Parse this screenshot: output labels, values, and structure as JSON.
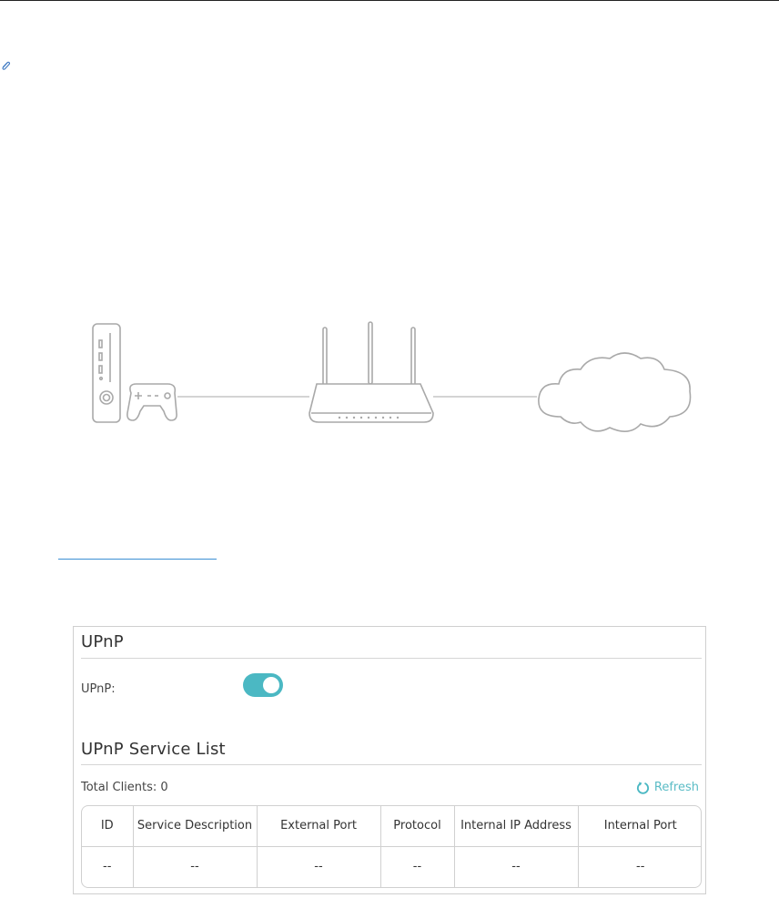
{
  "upnp_section": {
    "title": "UPnP",
    "toggle_label": "UPnP:",
    "toggle_state": "on"
  },
  "service_list": {
    "title": "UPnP Service List",
    "total_clients": "Total Clients: 0",
    "refresh_label": "Refresh",
    "columns": [
      "ID",
      "Service Description",
      "External Port",
      "Protocol",
      "Internal IP Address",
      "Internal Port"
    ],
    "rows": [
      [
        "--",
        "--",
        "--",
        "--",
        "--",
        "--"
      ]
    ]
  },
  "colors": {
    "accent": "#4bb8c3",
    "refresh": "#5bbcc6",
    "link": "#3c8fd4",
    "border": "#d0d0d0"
  },
  "icons": [
    "paperclip-icon",
    "game-console-icon",
    "gamepad-icon",
    "router-icon",
    "cloud-icon",
    "refresh-icon"
  ]
}
